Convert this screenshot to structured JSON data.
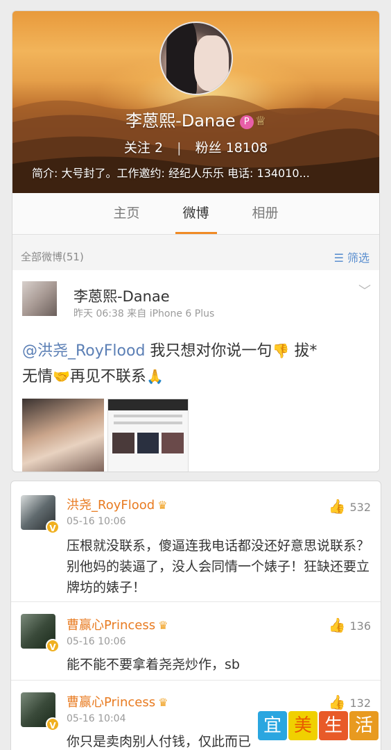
{
  "profile": {
    "name": "李蒽熙-Danae",
    "badge_p": "P",
    "crown": "♕",
    "follow_label": "关注",
    "follow_count": "2",
    "separator": "|",
    "fans_label": "粉丝",
    "fans_count": "18108",
    "bio": "简介: 大号封了。工作邀约: 经纪人乐乐 电话: 134010..."
  },
  "tabs": [
    {
      "label": "主页",
      "active": false
    },
    {
      "label": "微博",
      "active": true
    },
    {
      "label": "相册",
      "active": false
    }
  ],
  "filter": {
    "left": "全部微博(51)",
    "right": "☰ 筛选"
  },
  "post": {
    "author": "李蒽熙-Danae",
    "meta": "昨天 06:38  来自 iPhone 6 Plus",
    "chevron": "﹀",
    "mention": "@洪尧_RoyFlood",
    "text1": " 我只想对你说一句",
    "emoji1": "👎",
    "text2": " 拔*",
    "text3": "无情",
    "emoji2": "🤝",
    "text4": "再见不联系",
    "emoji3": "🙏"
  },
  "comments": [
    {
      "name": "洪尧_RoyFlood",
      "crown": "♛",
      "time": "05-16 10:06",
      "text": "压根就没联系，傻逼连我电话都没还好意思说联系？别他妈的装逼了，没人会同情一个婊子！狂缺还要立牌坊的婊子！",
      "likes": "532",
      "vbadge": "V"
    },
    {
      "name": "曹赢心Princess",
      "crown": "♛",
      "time": "05-16 10:06",
      "text": "能不能不要拿着尧尧炒作，sb",
      "likes": "136",
      "vbadge": "V"
    },
    {
      "name": "曹赢心Princess",
      "crown": "♛",
      "time": "05-16 10:04",
      "text": "你只是卖肉别人付钱，仅此而已",
      "likes": "132",
      "vbadge": "V"
    }
  ],
  "icons": {
    "like": "👍"
  },
  "watermark": [
    "宜",
    "美",
    "生",
    "活"
  ]
}
